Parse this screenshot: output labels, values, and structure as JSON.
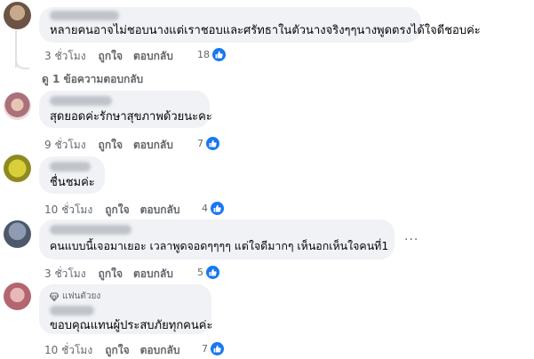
{
  "comments": [
    {
      "text": "หลายคนอาจไม่ชอบนางแต่เราชอบและศรัทธาในตัวนางจริงๆๆนางพูดตรงได้ใจดีชอบค่ะ",
      "time": "3 ชั่วโมง",
      "like_label": "ถูกใจ",
      "reply_label": "ตอบกลับ",
      "reaction_count": "18"
    },
    {
      "text": "สุดยอดค่ะรักษาสุขภาพด้วยนะคะ",
      "time": "9 ชั่วโมง",
      "like_label": "ถูกใจ",
      "reply_label": "ตอบกลับ",
      "reaction_count": "7"
    },
    {
      "text": "ชื่นชมค่ะ",
      "time": "10 ชั่วโมง",
      "like_label": "ถูกใจ",
      "reply_label": "ตอบกลับ",
      "reaction_count": "4"
    },
    {
      "text": "คนแบบนี้เจอมาเยอะ เวลาพูดจอดๆๆๆๆ แต่ใจดีมากๆ เห็นอกเห็นใจคนที่1",
      "time": "3 ชั่วโมง",
      "like_label": "ถูกใจ",
      "reply_label": "ตอบกลับ",
      "reaction_count": "5"
    },
    {
      "badge": "แฟนตัวยง",
      "text": "ขอบคุณแทนผู้ประสบภัยทุกคนค่ะ",
      "time": "10 ชั่วโมง",
      "like_label": "ถูกใจ",
      "reply_label": "ตอบกลับ",
      "reaction_count": "7"
    }
  ],
  "replies_link": "ดู 1 ข้อความตอบกลับ",
  "more_options": "···",
  "icons": {
    "reaction": "like-icon",
    "badge": "diamond-icon",
    "more": "more-options-icon"
  },
  "colors": {
    "bubble": "#f0f2f5",
    "like_blue": "#1877f2",
    "meta_gray": "#65676b"
  }
}
